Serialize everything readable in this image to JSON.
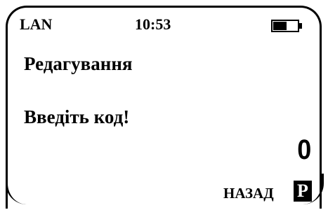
{
  "status_bar": {
    "network": "LAN",
    "time": "10:53",
    "battery_level": 0.55,
    "battery_icon": "battery-icon"
  },
  "screen": {
    "title": "Редагування",
    "prompt": "Введіть код!",
    "code_value": "0"
  },
  "softkeys": {
    "back_label": "НАЗАД",
    "back_key": "P"
  },
  "colors": {
    "foreground": "#000000",
    "background": "#ffffff"
  }
}
